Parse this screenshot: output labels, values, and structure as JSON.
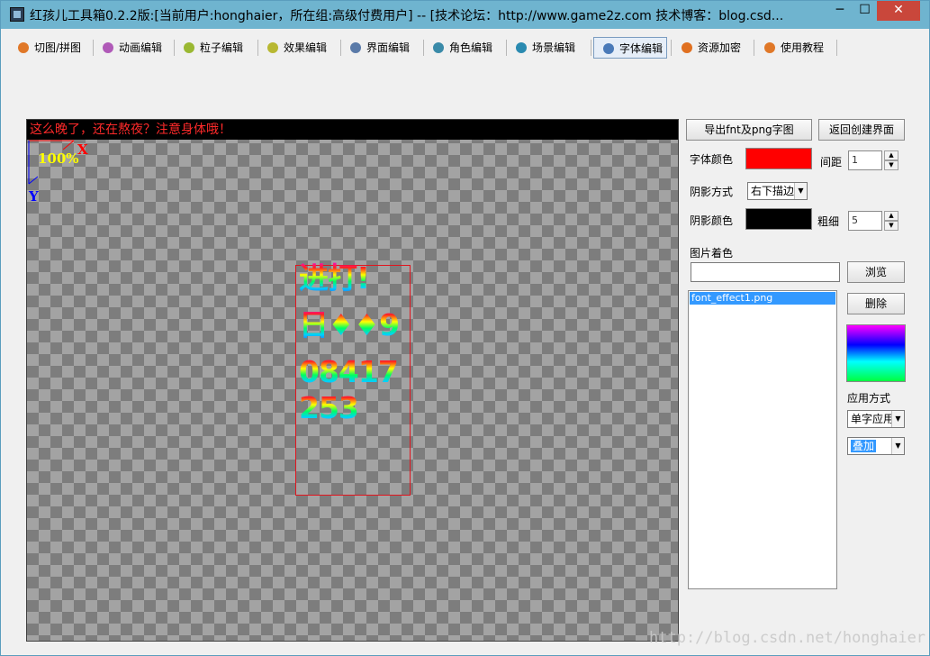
{
  "window": {
    "title": "红孩儿工具箱0.2.2版:[当前用户:honghaier，所在组:高级付费用户]  --  [技术论坛：http://www.game2z.com 技术博客：blog.csd...",
    "min_glyph": "─",
    "max_glyph": "☐",
    "close_glyph": "✕"
  },
  "toolbar": {
    "items": [
      {
        "label": "切图/拼图",
        "color": "#e07828"
      },
      {
        "label": "动画编辑",
        "color": "#b05ab8"
      },
      {
        "label": "粒子编辑",
        "color": "#9ab832"
      },
      {
        "label": "效果编辑",
        "color": "#b8b832"
      },
      {
        "label": "界面编辑",
        "color": "#5a7aa8"
      },
      {
        "label": "角色编辑",
        "color": "#3a8aa8"
      },
      {
        "label": "场景编辑",
        "color": "#2a8ab0"
      },
      {
        "label": "字体编辑",
        "color": "#4a7ab8"
      },
      {
        "label": "资源加密",
        "color": "#e07020"
      },
      {
        "label": "使用教程",
        "color": "#e07828"
      }
    ],
    "active_index": 7
  },
  "canvas": {
    "banner": "这么晚了，还在熬夜？注意身体哦！",
    "zoom": "100%",
    "x_axis": "X",
    "y_axis": "Y",
    "glyph_rows": [
      "进打!",
      "日♦♦9",
      "08417",
      "253"
    ]
  },
  "panel": {
    "export_button": "导出fnt及png字图",
    "back_button": "返回创建界面",
    "font_color_label": "字体颜色",
    "font_color": "#ff0000",
    "spacing_label": "间距",
    "spacing_value": "1",
    "shadow_mode_label": "阴影方式",
    "shadow_mode_value": "右下描边",
    "shadow_color_label": "阴影颜色",
    "shadow_color": "#000000",
    "thickness_label": "粗细",
    "thickness_value": "5",
    "image_tint_label": "图片着色",
    "image_path": "",
    "browse_button": "浏览",
    "files": [
      "font_effect1.png"
    ],
    "delete_button": "删除",
    "apply_mode_label": "应用方式",
    "apply_mode_value": "单字应用",
    "blend_mode_value": "叠加"
  },
  "watermark": "http://blog.csdn.net/honghaier"
}
